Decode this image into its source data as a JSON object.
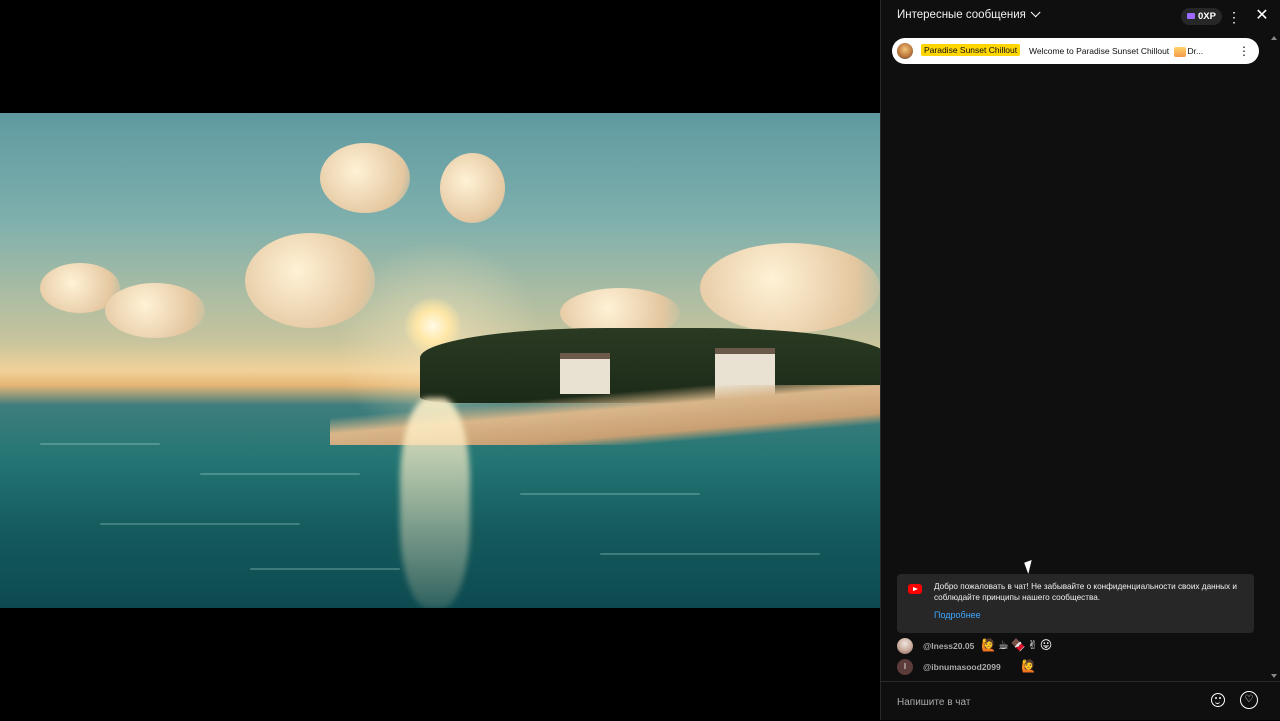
{
  "chat": {
    "header": {
      "title": "Интересные сообщения",
      "xp_label": "0XP",
      "more_icon": "vertical-dots-icon",
      "close_icon": "close-icon"
    },
    "pinned": {
      "channel": "Paradise Sunset Chillout",
      "message": "Welcome to Paradise Sunset Chillout",
      "message_tail": "Dr..."
    },
    "welcome": {
      "text": "Добро пожаловать в чат! Не забывайте о конфиденциальности своих данных и соблюдайте принципы нашего сообщества.",
      "more_link": "Подробнее"
    },
    "messages": [
      {
        "user": "@Iness20.05",
        "emojis": "🙋☕🍫✌😛"
      },
      {
        "user": "@ibnumasood2099",
        "emojis": "🙋"
      }
    ],
    "input": {
      "placeholder": "Напишите в чат"
    }
  },
  "colors": {
    "panel_bg": "#0f0f0f",
    "accent_link": "#3ea6ff",
    "channel_highlight": "#ffd600",
    "youtube_red": "#ff0000"
  }
}
